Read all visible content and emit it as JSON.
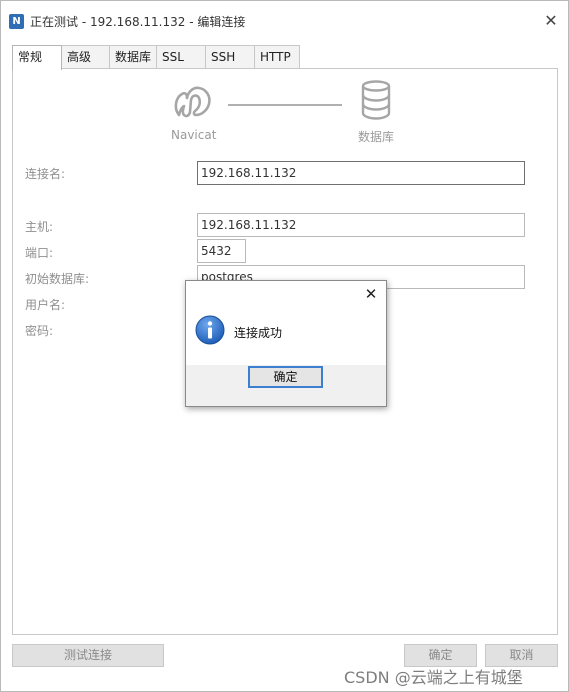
{
  "window": {
    "title": "正在测试 - 192.168.11.132 - 编辑连接",
    "close_glyph": "✕"
  },
  "tabs": [
    {
      "label": "常规",
      "active": true
    },
    {
      "label": "高级",
      "active": false
    },
    {
      "label": "数据库",
      "active": false
    },
    {
      "label": "SSL",
      "active": false
    },
    {
      "label": "SSH",
      "active": false
    },
    {
      "label": "HTTP",
      "active": false
    }
  ],
  "diagram": {
    "left_label": "Navicat",
    "right_label": "数据库",
    "left_icon": "navicat-logo-icon",
    "right_icon": "database-icon"
  },
  "form": {
    "connection_name_label": "连接名:",
    "connection_name_value": "192.168.11.132",
    "host_label": "主机:",
    "host_value": "192.168.11.132",
    "port_label": "端口:",
    "port_value": "5432",
    "initial_db_label": "初始数据库:",
    "initial_db_value": "postgres",
    "username_label": "用户名:",
    "password_label": "密码:"
  },
  "footer": {
    "test_button": "测试连接",
    "ok_button": "确定",
    "cancel_button": "取消"
  },
  "dialog": {
    "message": "连接成功",
    "ok_button": "确定",
    "close_glyph": "✕",
    "icon": "info-icon"
  },
  "watermark": "CSDN @云端之上有城堡",
  "colors": {
    "accent": "#3c7fd1",
    "info_icon_blue": "#1f5fb8"
  }
}
